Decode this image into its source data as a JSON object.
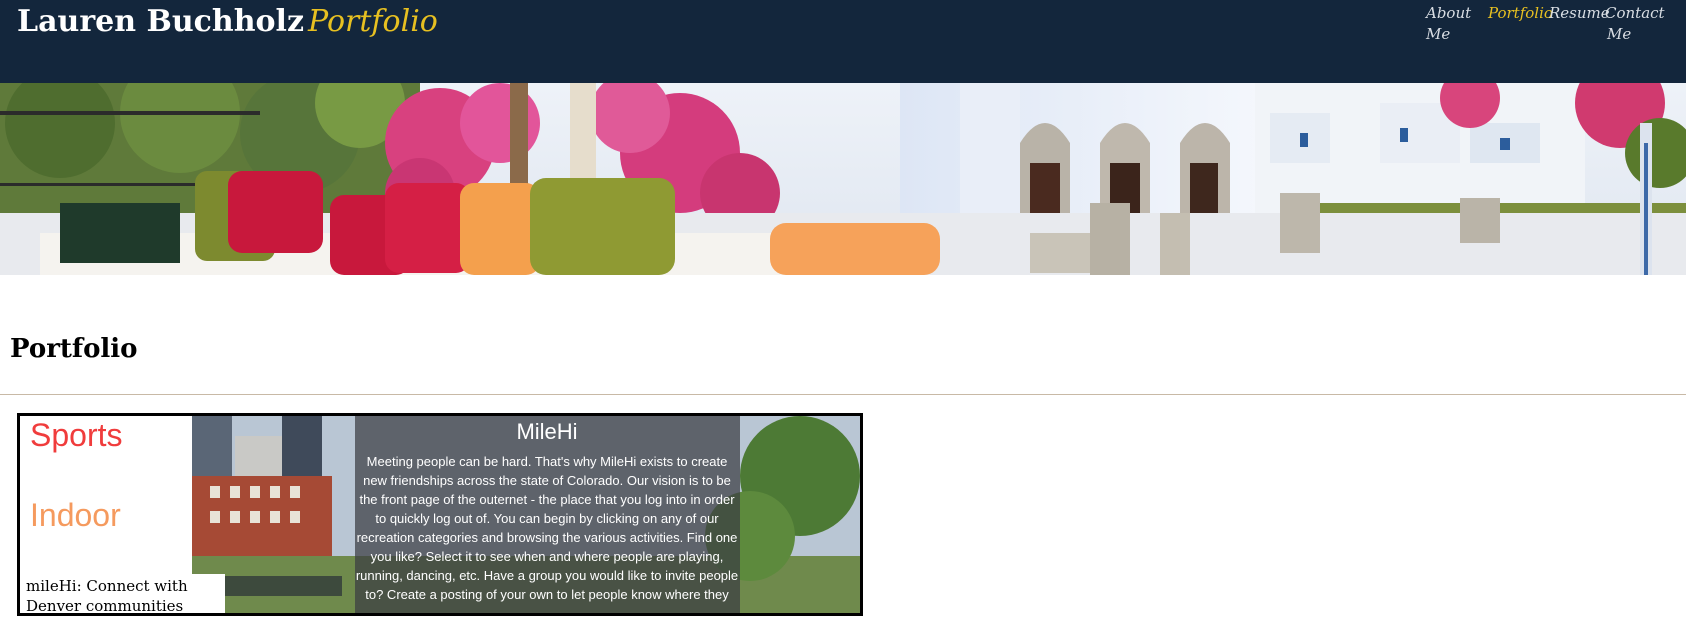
{
  "navbar": {
    "brand_name": "Lauren Buchholz",
    "brand_accent": "Portfolio",
    "links": [
      {
        "label_line1": "About",
        "label_line2": "Me",
        "active": false
      },
      {
        "label_line1": "Portfolio",
        "label_line2": "",
        "active": true
      },
      {
        "label_line1": "Resume",
        "label_line2": "",
        "active": false
      },
      {
        "label_line1": "Contact",
        "label_line2": "Me",
        "active": false
      }
    ]
  },
  "main": {
    "title": "Portfolio"
  },
  "projects": [
    {
      "caption": "mileHi: Connect with Denver communities",
      "screenshot": {
        "category_sports": "Sports",
        "category_indoor": "Indoor",
        "app_title": "MileHi",
        "description_lines": [
          "Meeting people can be hard. That's why MileHi exists to create",
          "new friendships across the state of Colorado. Our vision is to be",
          "the front page of the outernet - the place that you log into in order",
          "to quickly log out of. You can begin by clicking on any of our",
          "recreation categories and browsing the various activities. Find one",
          "you like? Select it to see when and where people are playing,",
          "running, dancing, etc. Have a group you would like to invite people",
          "to? Create a posting of your own to let people know where they"
        ]
      }
    }
  ],
  "colors": {
    "navbar_bg": "#13263c",
    "accent": "#e7c021",
    "divider": "#c8b9a6"
  }
}
